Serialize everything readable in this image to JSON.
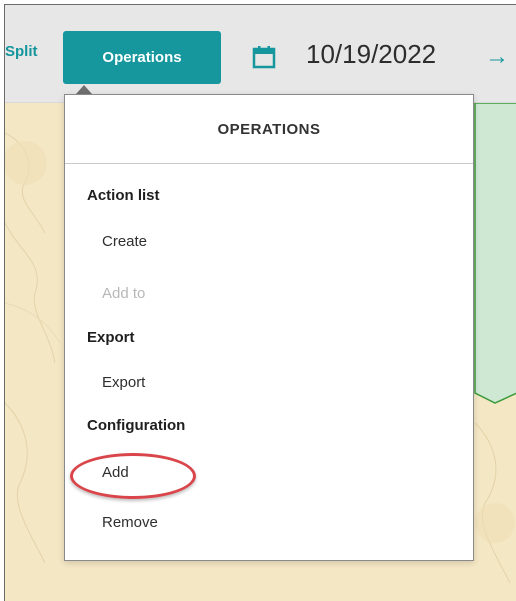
{
  "toolbar": {
    "split_label": "Split",
    "operations_label": "Operations",
    "date_value": "10/19/2022",
    "next_arrow": "→"
  },
  "icons": {
    "calendar": "calendar-icon",
    "arrow": "arrow-right-icon"
  },
  "colors": {
    "accent": "#16979d",
    "highlight_ring": "#d9454a",
    "map_background": "#f4e7c4",
    "map_green": "#cfe8d4"
  },
  "operations_menu": {
    "title": "OPERATIONS",
    "sections": [
      {
        "title": "Action list",
        "items": [
          {
            "label": "Create",
            "enabled": true
          },
          {
            "label": "Add to",
            "enabled": false
          }
        ]
      },
      {
        "title": "Export",
        "items": [
          {
            "label": "Export",
            "enabled": true
          }
        ]
      },
      {
        "title": "Configuration",
        "items": [
          {
            "label": "Add",
            "enabled": true,
            "highlighted": true
          },
          {
            "label": "Remove",
            "enabled": true
          }
        ]
      }
    ]
  }
}
